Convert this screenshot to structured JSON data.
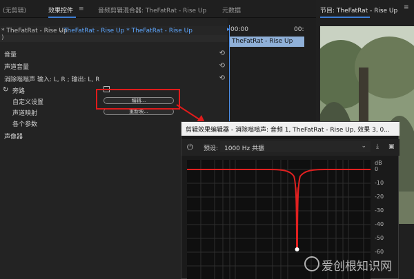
{
  "top_tabs": {
    "source": "(无剪辑)",
    "effect_controls": "效果控件",
    "effect_controls_menu": "≡",
    "audio_mixer": "音频剪辑混合器: TheFatRat - Rise Up",
    "metadata": "元数据"
  },
  "clip_header": {
    "source_clip": "* TheFatRat - Rise Up",
    "sequence_clip": "TheFatRat - Rise Up * TheFatRat - Rise Up"
  },
  "properties": {
    "volume": "音量",
    "channel_volume": "声道音量",
    "denoise": "消除嗡嗡声 输入: L, R ; 输出: L, R",
    "bypass": "旁路",
    "custom_setup": "自定义设置",
    "edit_button": "编辑...",
    "channel_map": "声道映射",
    "remap_button": "重新映...",
    "params": "各个参数",
    "panner": "声像器",
    "reset_symbol": "⟲"
  },
  "timeline": {
    "time_start": "00:00",
    "time_end": "00:",
    "clip_name": "TheFatRat - Rise Up"
  },
  "program": {
    "title": "节目: TheFatRat - Rise Up",
    "menu": "≡"
  },
  "dialog": {
    "title": "剪辑效果编辑器 - 消除嗡嗡声: 音频 1, TheFatRat - Rise Up, 效果 3, 0...",
    "preset_label": "预设:",
    "preset_value": "1000 Hz 共振",
    "db_labels": [
      "dB",
      "0",
      "-10",
      "-20",
      "-30",
      "-40",
      "-50",
      "-60"
    ]
  },
  "watermark": "爱创根知识网",
  "colors": {
    "accent": "#3d7ed6",
    "highlight": "#e01b1b",
    "curve": "#e02020"
  }
}
